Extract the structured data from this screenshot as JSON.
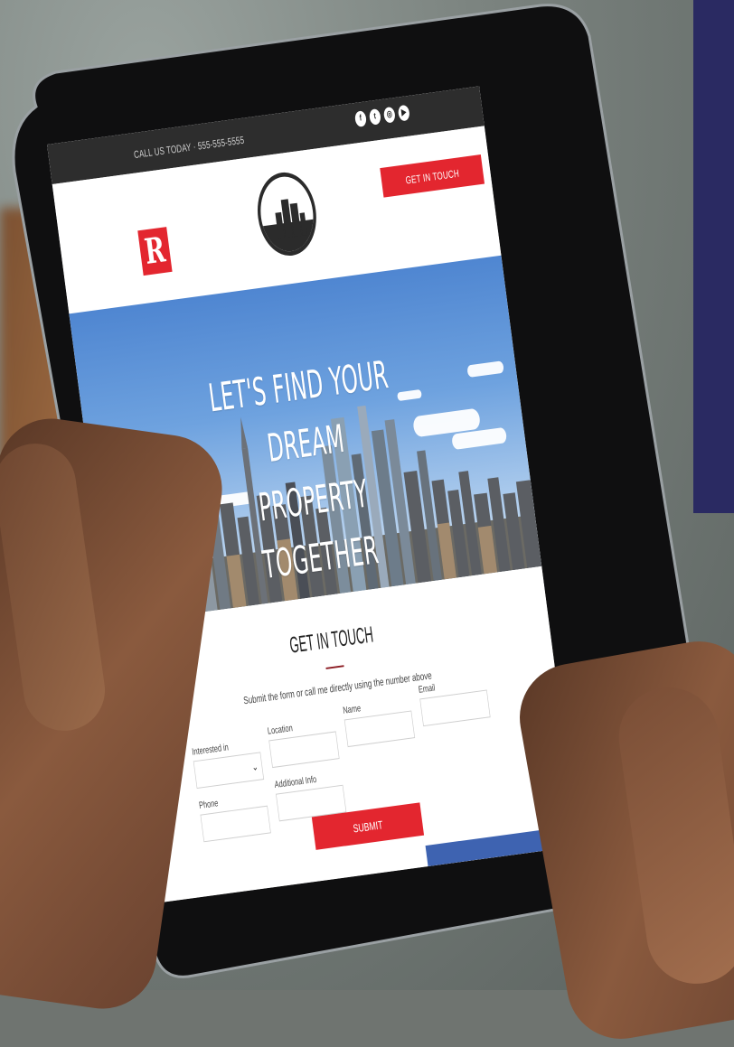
{
  "topbar": {
    "phone_text": "CALL US TODAY · 555-555-5555",
    "social_icons": [
      "facebook-icon",
      "twitter-icon",
      "instagram-icon",
      "youtube-icon"
    ],
    "social_glyphs": [
      "f",
      "t",
      "◎",
      "▶"
    ]
  },
  "header": {
    "logo_letter": "R",
    "cta_label": "GET IN TOUCH"
  },
  "hero": {
    "headline_line1": "LET'S FIND YOUR DREAM",
    "headline_line2": "PROPERTY TOGETHER"
  },
  "contact": {
    "title": "GET IN TOUCH",
    "subtitle": "Submit the form or call me directly using the number above",
    "fields": {
      "interested_in": {
        "label": "Interested in",
        "value": ""
      },
      "location": {
        "label": "Location",
        "value": ""
      },
      "name": {
        "label": "Name",
        "value": ""
      },
      "email": {
        "label": "Email",
        "value": ""
      },
      "phone": {
        "label": "Phone",
        "value": ""
      },
      "additional_info": {
        "label": "Additional Info",
        "value": ""
      }
    },
    "submit_label": "SUBMIT"
  },
  "colors": {
    "accent_red": "#e3262f",
    "topbar": "#2d2d2d",
    "strip_blue": "#3e63b1",
    "accessibility_blue": "#1f63c9"
  }
}
